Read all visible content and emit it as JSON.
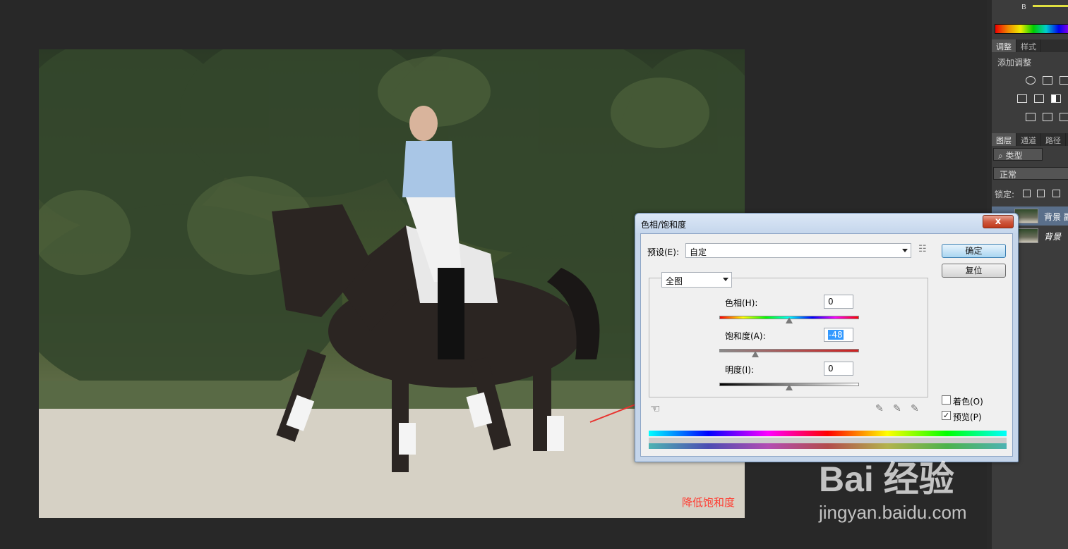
{
  "canvas": {
    "caption": "降低饱和度"
  },
  "right_panel": {
    "color_channel_label": "B",
    "adjust_tabs": [
      "调整",
      "样式"
    ],
    "adjust_add_label": "添加调整",
    "layers_tabs": [
      "图层",
      "通道",
      "路径"
    ],
    "filter_kind": "类型",
    "blend_mode": "正常",
    "lock_label": "锁定:",
    "layers": [
      {
        "name": "背景 副本",
        "active": true
      },
      {
        "name": "背景",
        "active": false
      }
    ]
  },
  "dialog": {
    "title": "色相/饱和度",
    "close_label": "x",
    "preset_label": "预设(E):",
    "preset_value": "自定",
    "ok_label": "确定",
    "reset_label": "复位",
    "channel_value": "全图",
    "hue": {
      "label": "色相(H):",
      "value": "0",
      "fraction": 0.5
    },
    "saturation": {
      "label": "饱和度(A):",
      "value": "-48",
      "fraction": 0.26
    },
    "lightness": {
      "label": "明度(I):",
      "value": "0",
      "fraction": 0.5
    },
    "colorize_label": "着色(O)",
    "colorize_checked": false,
    "preview_label": "预览(P)",
    "preview_checked": true
  },
  "watermark": {
    "logo": "Bai 经验",
    "url": "jingyan.baidu.com"
  },
  "colors": {
    "caption_red": "#ff3b30",
    "arrow_red": "#e8322e",
    "selection_blue": "#3399ff"
  }
}
